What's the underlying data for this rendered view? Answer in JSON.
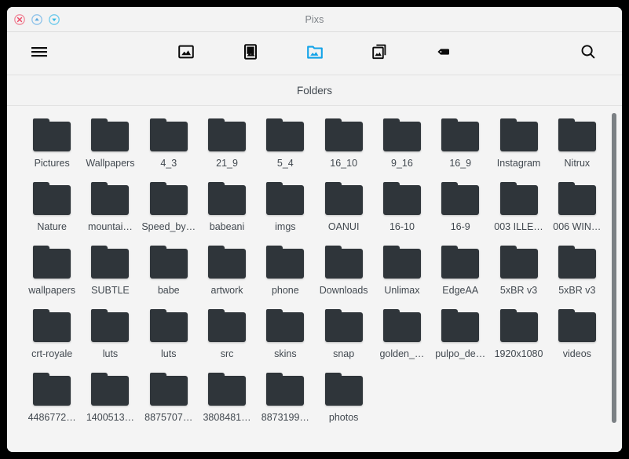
{
  "window": {
    "title": "Pixs",
    "controls": [
      {
        "name": "close",
        "icon": "close-icon",
        "color": "#f08a9b"
      },
      {
        "name": "maximize",
        "icon": "arrow-up-icon",
        "color": "#7fb8e8"
      },
      {
        "name": "minimize",
        "icon": "arrow-down-icon",
        "color": "#49c0e8"
      }
    ]
  },
  "toolbar": {
    "menu_icon": "hamburger-menu-icon",
    "search_icon": "search-icon",
    "accent_color": "#13a3e8",
    "views": [
      {
        "id": "gallery",
        "icon": "image-icon",
        "label": "Gallery",
        "active": false
      },
      {
        "id": "pictures",
        "icon": "picture-frame-icon",
        "label": "Pictures",
        "active": false
      },
      {
        "id": "folders",
        "icon": "folder-image-icon",
        "label": "Folders",
        "active": true
      },
      {
        "id": "albums",
        "icon": "stacked-images-icon",
        "label": "Albums",
        "active": false
      },
      {
        "id": "tags",
        "icon": "tag-icon",
        "label": "Tags",
        "active": false
      }
    ]
  },
  "section": {
    "title": "Folders"
  },
  "folders": [
    {
      "name": "Pictures"
    },
    {
      "name": "Wallpapers"
    },
    {
      "name": "4_3"
    },
    {
      "name": "21_9"
    },
    {
      "name": "5_4"
    },
    {
      "name": "16_10"
    },
    {
      "name": "9_16"
    },
    {
      "name": "16_9"
    },
    {
      "name": "Instagram"
    },
    {
      "name": "Nitrux"
    },
    {
      "name": "Nature"
    },
    {
      "name": "mountai…"
    },
    {
      "name": "Speed_by…"
    },
    {
      "name": "babeani"
    },
    {
      "name": "imgs"
    },
    {
      "name": "OANUI"
    },
    {
      "name": "16-10"
    },
    {
      "name": "16-9"
    },
    {
      "name": "003 ILLE…"
    },
    {
      "name": "006 WIN…"
    },
    {
      "name": "wallpapers"
    },
    {
      "name": "SUBTLE"
    },
    {
      "name": "babe"
    },
    {
      "name": "artwork"
    },
    {
      "name": "phone"
    },
    {
      "name": "Downloads"
    },
    {
      "name": "Unlimax"
    },
    {
      "name": "EdgeAA"
    },
    {
      "name": "5xBR v3"
    },
    {
      "name": "5xBR v3"
    },
    {
      "name": "crt-royale"
    },
    {
      "name": "luts"
    },
    {
      "name": "luts"
    },
    {
      "name": "src"
    },
    {
      "name": "skins"
    },
    {
      "name": "snap"
    },
    {
      "name": "golden_…"
    },
    {
      "name": "pulpo_de…"
    },
    {
      "name": "1920x1080"
    },
    {
      "name": "videos"
    },
    {
      "name": "4486772…"
    },
    {
      "name": "1400513…"
    },
    {
      "name": "8875707…"
    },
    {
      "name": "3808481…"
    },
    {
      "name": "8873199…"
    },
    {
      "name": "photos"
    }
  ],
  "scrollbar": {
    "orientation": "vertical"
  }
}
